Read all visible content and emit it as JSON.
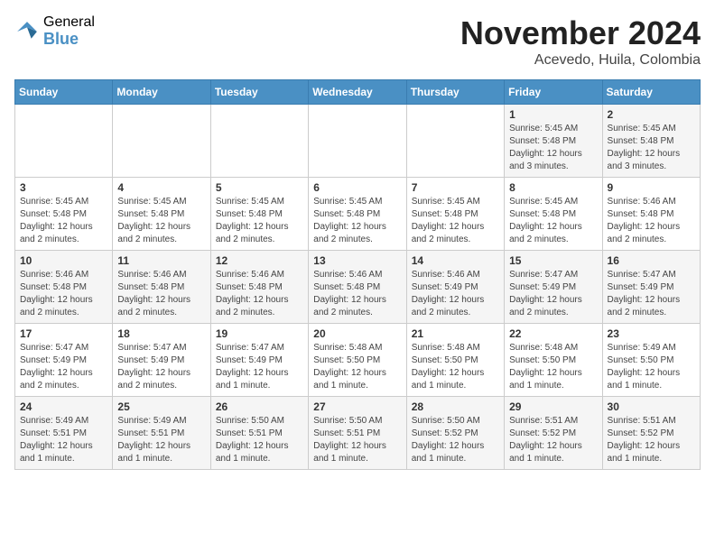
{
  "logo": {
    "general": "General",
    "blue": "Blue"
  },
  "title": "November 2024",
  "location": "Acevedo, Huila, Colombia",
  "days_of_week": [
    "Sunday",
    "Monday",
    "Tuesday",
    "Wednesday",
    "Thursday",
    "Friday",
    "Saturday"
  ],
  "weeks": [
    [
      {
        "day": "",
        "info": ""
      },
      {
        "day": "",
        "info": ""
      },
      {
        "day": "",
        "info": ""
      },
      {
        "day": "",
        "info": ""
      },
      {
        "day": "",
        "info": ""
      },
      {
        "day": "1",
        "info": "Sunrise: 5:45 AM\nSunset: 5:48 PM\nDaylight: 12 hours\nand 3 minutes."
      },
      {
        "day": "2",
        "info": "Sunrise: 5:45 AM\nSunset: 5:48 PM\nDaylight: 12 hours\nand 3 minutes."
      }
    ],
    [
      {
        "day": "3",
        "info": "Sunrise: 5:45 AM\nSunset: 5:48 PM\nDaylight: 12 hours\nand 2 minutes."
      },
      {
        "day": "4",
        "info": "Sunrise: 5:45 AM\nSunset: 5:48 PM\nDaylight: 12 hours\nand 2 minutes."
      },
      {
        "day": "5",
        "info": "Sunrise: 5:45 AM\nSunset: 5:48 PM\nDaylight: 12 hours\nand 2 minutes."
      },
      {
        "day": "6",
        "info": "Sunrise: 5:45 AM\nSunset: 5:48 PM\nDaylight: 12 hours\nand 2 minutes."
      },
      {
        "day": "7",
        "info": "Sunrise: 5:45 AM\nSunset: 5:48 PM\nDaylight: 12 hours\nand 2 minutes."
      },
      {
        "day": "8",
        "info": "Sunrise: 5:45 AM\nSunset: 5:48 PM\nDaylight: 12 hours\nand 2 minutes."
      },
      {
        "day": "9",
        "info": "Sunrise: 5:46 AM\nSunset: 5:48 PM\nDaylight: 12 hours\nand 2 minutes."
      }
    ],
    [
      {
        "day": "10",
        "info": "Sunrise: 5:46 AM\nSunset: 5:48 PM\nDaylight: 12 hours\nand 2 minutes."
      },
      {
        "day": "11",
        "info": "Sunrise: 5:46 AM\nSunset: 5:48 PM\nDaylight: 12 hours\nand 2 minutes."
      },
      {
        "day": "12",
        "info": "Sunrise: 5:46 AM\nSunset: 5:48 PM\nDaylight: 12 hours\nand 2 minutes."
      },
      {
        "day": "13",
        "info": "Sunrise: 5:46 AM\nSunset: 5:48 PM\nDaylight: 12 hours\nand 2 minutes."
      },
      {
        "day": "14",
        "info": "Sunrise: 5:46 AM\nSunset: 5:49 PM\nDaylight: 12 hours\nand 2 minutes."
      },
      {
        "day": "15",
        "info": "Sunrise: 5:47 AM\nSunset: 5:49 PM\nDaylight: 12 hours\nand 2 minutes."
      },
      {
        "day": "16",
        "info": "Sunrise: 5:47 AM\nSunset: 5:49 PM\nDaylight: 12 hours\nand 2 minutes."
      }
    ],
    [
      {
        "day": "17",
        "info": "Sunrise: 5:47 AM\nSunset: 5:49 PM\nDaylight: 12 hours\nand 2 minutes."
      },
      {
        "day": "18",
        "info": "Sunrise: 5:47 AM\nSunset: 5:49 PM\nDaylight: 12 hours\nand 2 minutes."
      },
      {
        "day": "19",
        "info": "Sunrise: 5:47 AM\nSunset: 5:49 PM\nDaylight: 12 hours\nand 1 minute."
      },
      {
        "day": "20",
        "info": "Sunrise: 5:48 AM\nSunset: 5:50 PM\nDaylight: 12 hours\nand 1 minute."
      },
      {
        "day": "21",
        "info": "Sunrise: 5:48 AM\nSunset: 5:50 PM\nDaylight: 12 hours\nand 1 minute."
      },
      {
        "day": "22",
        "info": "Sunrise: 5:48 AM\nSunset: 5:50 PM\nDaylight: 12 hours\nand 1 minute."
      },
      {
        "day": "23",
        "info": "Sunrise: 5:49 AM\nSunset: 5:50 PM\nDaylight: 12 hours\nand 1 minute."
      }
    ],
    [
      {
        "day": "24",
        "info": "Sunrise: 5:49 AM\nSunset: 5:51 PM\nDaylight: 12 hours\nand 1 minute."
      },
      {
        "day": "25",
        "info": "Sunrise: 5:49 AM\nSunset: 5:51 PM\nDaylight: 12 hours\nand 1 minute."
      },
      {
        "day": "26",
        "info": "Sunrise: 5:50 AM\nSunset: 5:51 PM\nDaylight: 12 hours\nand 1 minute."
      },
      {
        "day": "27",
        "info": "Sunrise: 5:50 AM\nSunset: 5:51 PM\nDaylight: 12 hours\nand 1 minute."
      },
      {
        "day": "28",
        "info": "Sunrise: 5:50 AM\nSunset: 5:52 PM\nDaylight: 12 hours\nand 1 minute."
      },
      {
        "day": "29",
        "info": "Sunrise: 5:51 AM\nSunset: 5:52 PM\nDaylight: 12 hours\nand 1 minute."
      },
      {
        "day": "30",
        "info": "Sunrise: 5:51 AM\nSunset: 5:52 PM\nDaylight: 12 hours\nand 1 minute."
      }
    ]
  ]
}
